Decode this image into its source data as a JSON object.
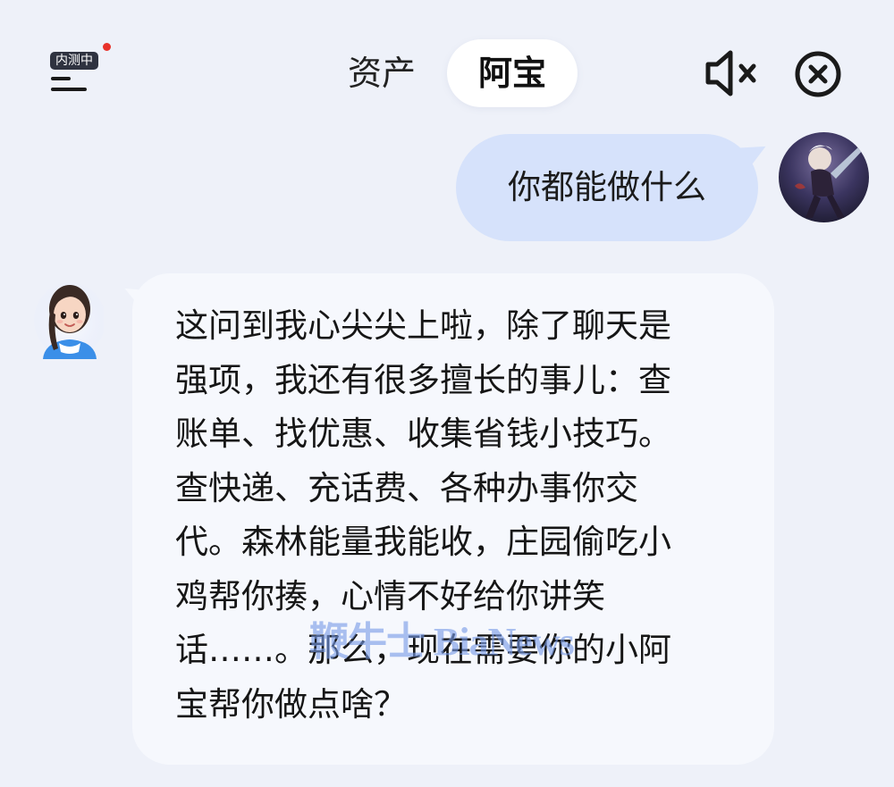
{
  "header": {
    "beta_badge": "内测中",
    "tabs": [
      {
        "label": "资产",
        "active": false
      },
      {
        "label": "阿宝",
        "active": true
      }
    ],
    "icons": {
      "menu": "menu-icon",
      "mute": "speaker-muted-icon",
      "close": "close-circle-icon"
    }
  },
  "chat": {
    "messages": [
      {
        "role": "user",
        "avatar": "user-avatar",
        "text": "你都能做什么"
      },
      {
        "role": "assistant",
        "avatar": "assistant-avatar",
        "lines": [
          "这问到我心尖尖上啦，除了聊天是",
          "强项，我还有很多擅长的事儿：查",
          "账单、找优惠、收集省钱小技巧。",
          "查快递、充话费、各种办事你交",
          "代。森林能量我能收，庄园偷吃小",
          "鸡帮你揍，心情不好给你讲笑",
          "话……。那么，现在需要你的小阿",
          "宝帮你做点啥？"
        ]
      }
    ]
  },
  "watermark": "鞭牛士 BiaNews",
  "colors": {
    "background": "#eef1f9",
    "user_bubble": "#d6e2fb",
    "assistant_bubble": "#f6f8fd",
    "badge_dot": "#e8322b",
    "badge_bg": "#2f3340"
  }
}
